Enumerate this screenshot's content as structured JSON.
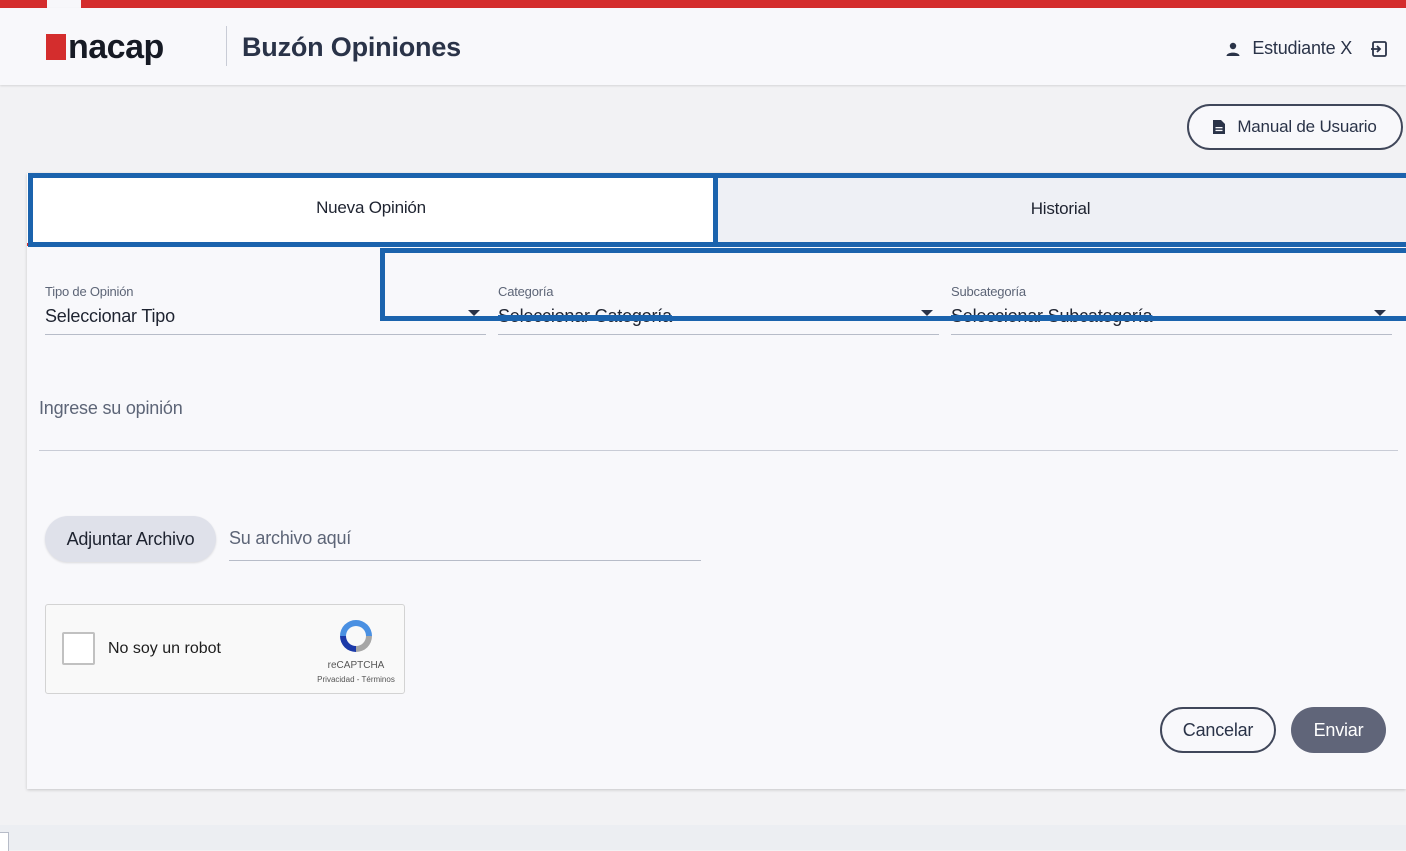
{
  "header": {
    "logo_text": "nacap",
    "app_title": "Buzón Opiniones",
    "user_name": "Estudiante X",
    "icons": {
      "user": "user-icon",
      "logout": "logout-icon"
    }
  },
  "manual_button": {
    "label": "Manual de Usuario",
    "icon": "document-icon"
  },
  "tabs": [
    {
      "label": "Nueva Opinión",
      "active": true
    },
    {
      "label": "Historial",
      "active": false
    }
  ],
  "form": {
    "tipo": {
      "label": "Tipo de Opinión",
      "value": "Seleccionar Tipo"
    },
    "categoria": {
      "label": "Categoría",
      "value": "Seleccionar Categoría"
    },
    "subcategoria": {
      "label": "Subcategoría",
      "value": "Seleccionar Subcategoría"
    },
    "opinion_placeholder": "Ingrese su opinión",
    "attach_label": "Adjuntar Archivo",
    "file_placeholder": "Su archivo aquí"
  },
  "recaptcha": {
    "label": "No soy un robot",
    "brand": "reCAPTCHA",
    "links": "Privacidad - Términos"
  },
  "actions": {
    "cancel": "Cancelar",
    "send": "Enviar"
  },
  "colors": {
    "accent_red": "#d42d2d",
    "highlight_blue": "#1b63ad",
    "send_button": "#606579"
  }
}
